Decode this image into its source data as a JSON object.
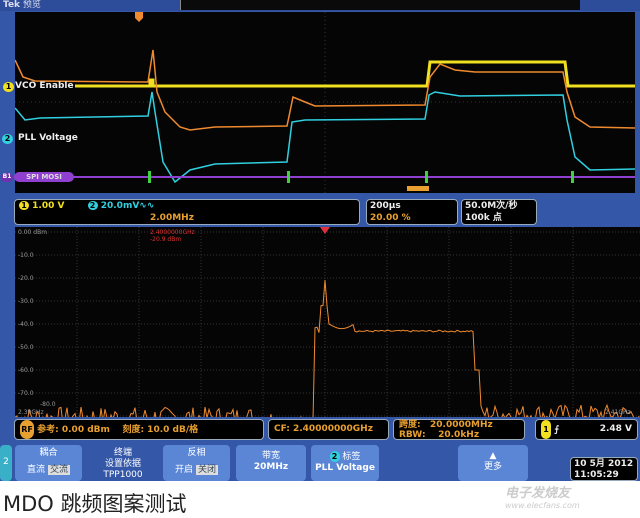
{
  "titlebar": {
    "brand": "Tek",
    "mode": "预览"
  },
  "channels": {
    "ch1_label": "VCO Enable",
    "ch2_label": "PLL Voltage",
    "bus_label": "SPI MOSI",
    "ch1_num": "1",
    "ch2_num": "2",
    "bus_num": "B1"
  },
  "status": {
    "ch1_scale": "1.00 V",
    "ch2_scale": "20.0mV",
    "ch2_coupling": "∿∿",
    "rf_freq": "2.00MHz",
    "timebase": "200μs",
    "trigger_pos": "20.00 %",
    "sample_rate": "50.0M次/秒",
    "record_length": "100k 点"
  },
  "spectrum": {
    "marker_freq": "2.4000000GHz",
    "marker_level": "-20.9 dBm",
    "y_labels": [
      "0.00 dBm",
      "-10.0",
      "-20.0",
      "-30.0",
      "-40.0",
      "-50.0",
      "-60.0",
      "-70.0",
      "-80.0"
    ],
    "x_start": "2.39GHz",
    "x_end": "2.41GHz"
  },
  "readouts": {
    "rf": "RF",
    "ref": "参考: 0.00 dBm",
    "scale": "刻度: 10.0 dB/格",
    "cf": "CF: 2.40000000GHz",
    "span_label": "跨度:",
    "span": "20.0000MHz",
    "rbw_label": "RBW:",
    "rbw": "20.0kHz",
    "trig_ch": "1",
    "trig_level": "2.48 V"
  },
  "softkeys": {
    "channel": "2",
    "coupling": "耦合",
    "dc": "直流",
    "ac": "交流",
    "term_l1": "终端",
    "term_l2": "设置依据",
    "probe": "TPP1000",
    "invert": "反相",
    "on": "开启",
    "off": "关闭",
    "bandwidth": "带宽",
    "bw_value": "20MHz",
    "label_num": "2",
    "label": "标签",
    "label_value": "PLL Voltage",
    "more": "更多",
    "date": "10 5月 2012",
    "time": "11:05:29"
  },
  "caption": "MDO 跳频图案测试",
  "watermark": {
    "name": "电子发烧友",
    "url": "www.elecfans.com"
  },
  "colors": {
    "ch1": "#f0e020",
    "ch2": "#30d0e0",
    "rf": "#f08a30",
    "bus": "#9040d0",
    "frame": "#3457a8"
  }
}
